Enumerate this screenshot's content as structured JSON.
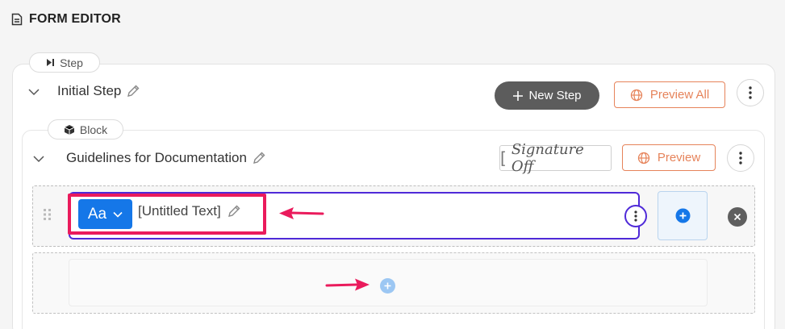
{
  "header": {
    "title": "FORM EDITOR",
    "icon": "document-icon"
  },
  "step": {
    "tag_label": "Step",
    "title": "Initial Step",
    "new_step_label": "New Step",
    "preview_all_label": "Preview All"
  },
  "block": {
    "tag_label": "Block",
    "title": "Guidelines for Documentation",
    "signature_label": "Signature Off",
    "preview_label": "Preview"
  },
  "field": {
    "type_label": "Aa",
    "label": "[Untitled Text]"
  },
  "colors": {
    "accent_orange": "#e6835a",
    "primary_blue": "#1577e8",
    "focus_purple": "#4f2ad8",
    "annotation_pink": "#ea1b5c",
    "dark_button": "#5c5c5c"
  }
}
